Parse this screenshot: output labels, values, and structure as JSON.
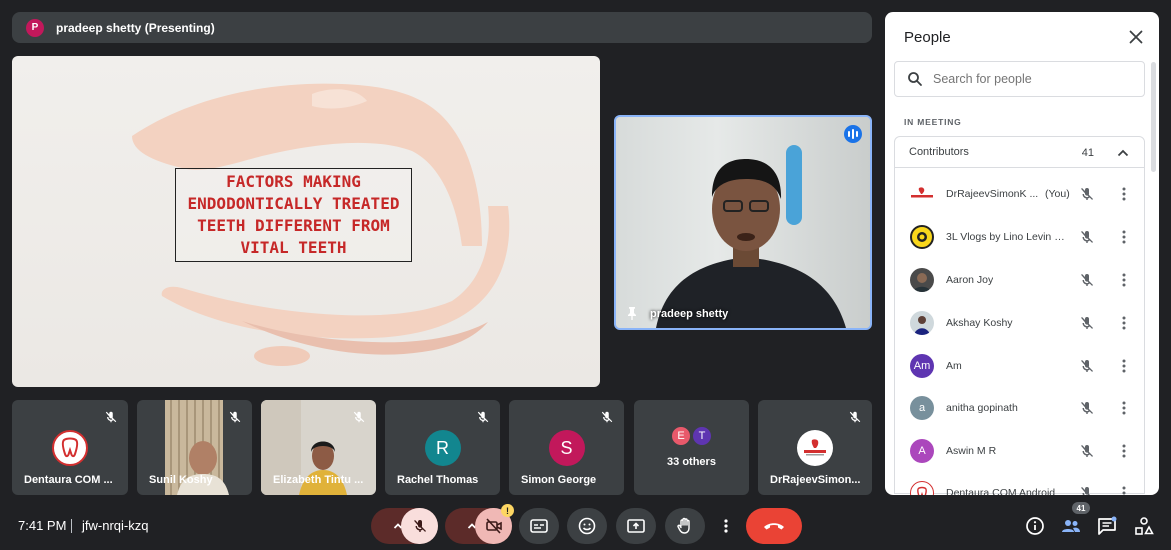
{
  "presenter_bar": {
    "avatar_letter": "P",
    "text": "pradeep shetty (Presenting)"
  },
  "slide": {
    "title_lines": [
      "FACTORS MAKING",
      "ENDODONTICALLY TREATED",
      "TEETH DIFFERENT FROM",
      "VITAL TEETH"
    ]
  },
  "speaker": {
    "name": "pradeep shetty"
  },
  "tiles": [
    {
      "name": "Dentaura COM ...",
      "avatar": "dentaura-logo-icon"
    },
    {
      "name": "Sunil Koshy",
      "avatar": "video"
    },
    {
      "name": "Elizabeth Tintu ...",
      "avatar": "video"
    },
    {
      "name": "Rachel Thomas",
      "letter": "R",
      "color": "#12868f"
    },
    {
      "name": "Simon George",
      "letter": "S",
      "color": "#c2185b"
    },
    {
      "name": "33 others",
      "letters": [
        "E",
        "T"
      ],
      "colors": [
        "#e8596b",
        "#5e35b1"
      ]
    },
    {
      "name": "DrRajeevSimon...",
      "avatar": "dentaura-brand-icon"
    }
  ],
  "people": {
    "title": "People",
    "search_placeholder": "Search for people",
    "section": "IN MEETING",
    "group": "Contributors",
    "count": "41",
    "rows": [
      {
        "name": "DrRajeevSimonK ...",
        "suffix": "(You)"
      },
      {
        "name": "3L Vlogs by Lino Levin L..."
      },
      {
        "name": "Aaron Joy"
      },
      {
        "name": "Akshay Koshy"
      },
      {
        "name": "Am",
        "letter": "Am",
        "color": "#5e35b1"
      },
      {
        "name": "anitha gopinath",
        "letter": "a",
        "color": "#78909c"
      },
      {
        "name": "Aswin M R",
        "letter": "A",
        "color": "#ab47bc"
      },
      {
        "name": "Dentaura COM Android"
      }
    ]
  },
  "bottom": {
    "time": "7:41 PM",
    "meeting_code": "jfw-nrqi-kzq",
    "people_badge": "41"
  }
}
